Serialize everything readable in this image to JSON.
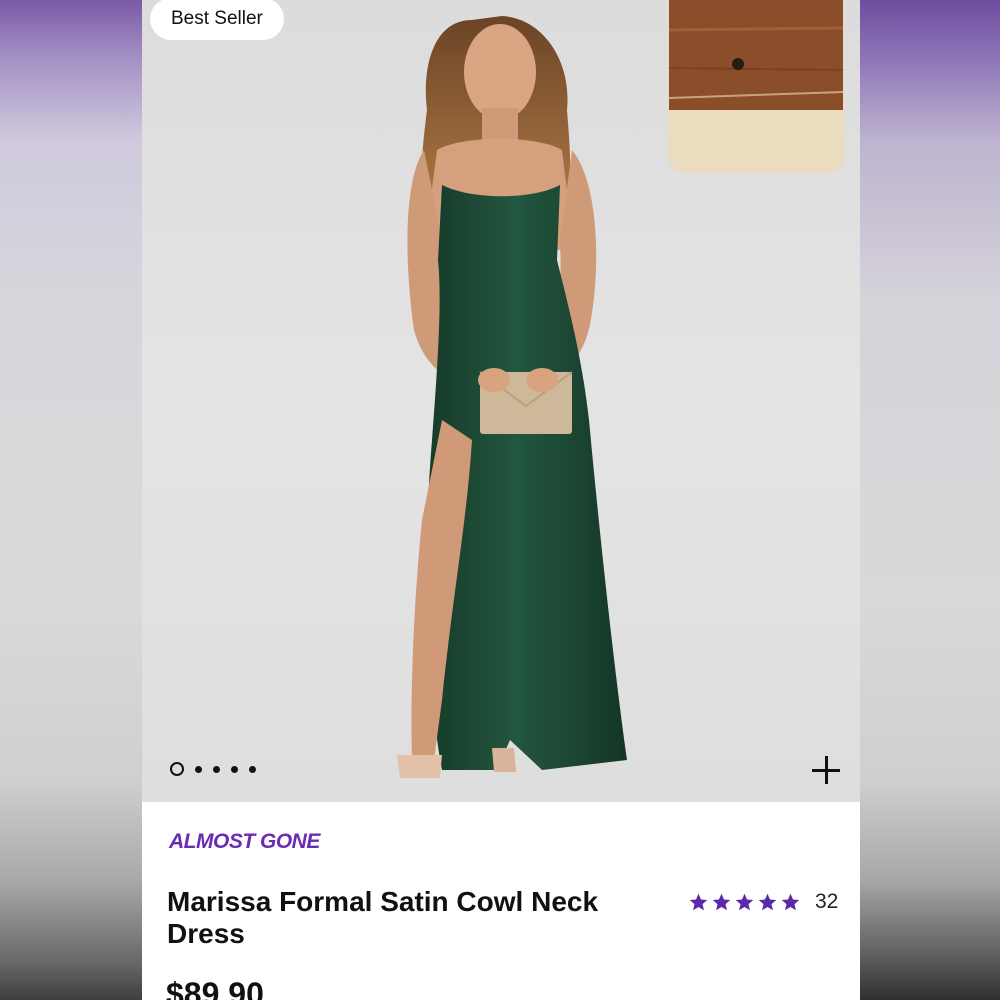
{
  "badge": {
    "label": "Best Seller"
  },
  "carousel": {
    "total_dots": 5,
    "active_index": 0
  },
  "product": {
    "status_label": "ALMOST GONE",
    "title": "Marissa Formal Satin Cowl Neck Dress",
    "rating_stars": 5,
    "review_count": "32",
    "price": "$89.90"
  },
  "colors": {
    "accent": "#6a2bb5",
    "dress": "#1f4a36",
    "star": "#5b2aa8"
  },
  "icons": {
    "add": "plus-icon",
    "star": "star-icon"
  }
}
